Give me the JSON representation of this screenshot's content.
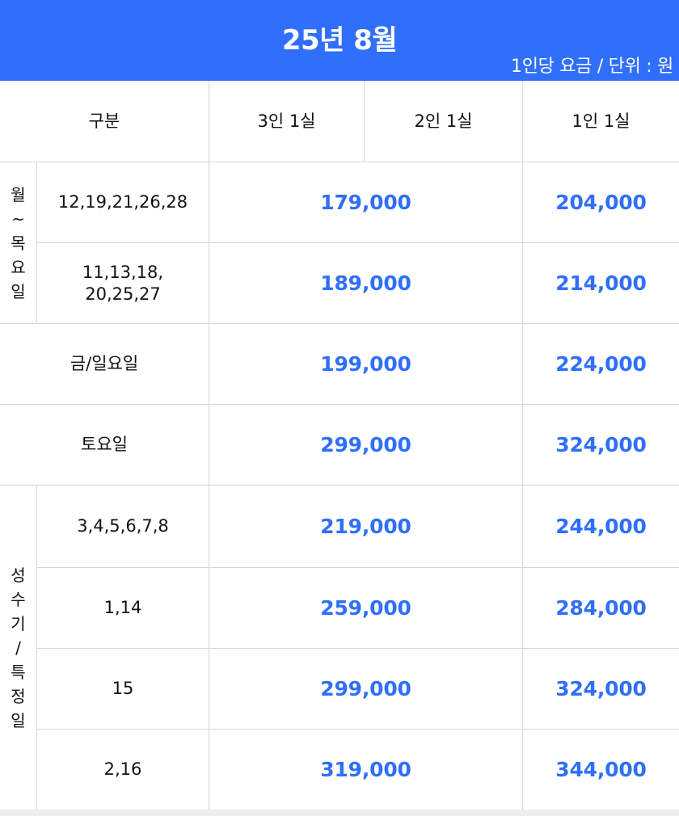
{
  "header": {
    "title": "25년 8월",
    "unit_note": "1인당 요금 / 단위 : 원",
    "background_color": "#2f6ffb"
  },
  "table": {
    "headers": {
      "category": "구분",
      "triple": "3인 1실",
      "double": "2인 1실",
      "single": "1인 1실"
    },
    "groups": {
      "weekday": [
        "월",
        "~",
        "목",
        "요",
        "일"
      ],
      "peak": [
        "성",
        "수",
        "기",
        "/",
        "특",
        "정",
        "일"
      ]
    },
    "rows": [
      {
        "dates": "12,19,21,26,28",
        "shared": "179,000",
        "single": "204,000"
      },
      {
        "dates_line1": "11,13,18,",
        "dates_line2": "20,25,27",
        "shared": "189,000",
        "single": "214,000"
      },
      {
        "label": "금/일요일",
        "shared": "199,000",
        "single": "224,000"
      },
      {
        "label": "토요일",
        "shared": "299,000",
        "single": "324,000"
      },
      {
        "dates": "3,4,5,6,7,8",
        "shared": "219,000",
        "single": "244,000"
      },
      {
        "dates": "1,14",
        "shared": "259,000",
        "single": "284,000"
      },
      {
        "dates": "15",
        "shared": "299,000",
        "single": "324,000"
      },
      {
        "dates": "2,16",
        "shared": "319,000",
        "single": "344,000"
      }
    ],
    "price_color": "#2f6ffb"
  }
}
